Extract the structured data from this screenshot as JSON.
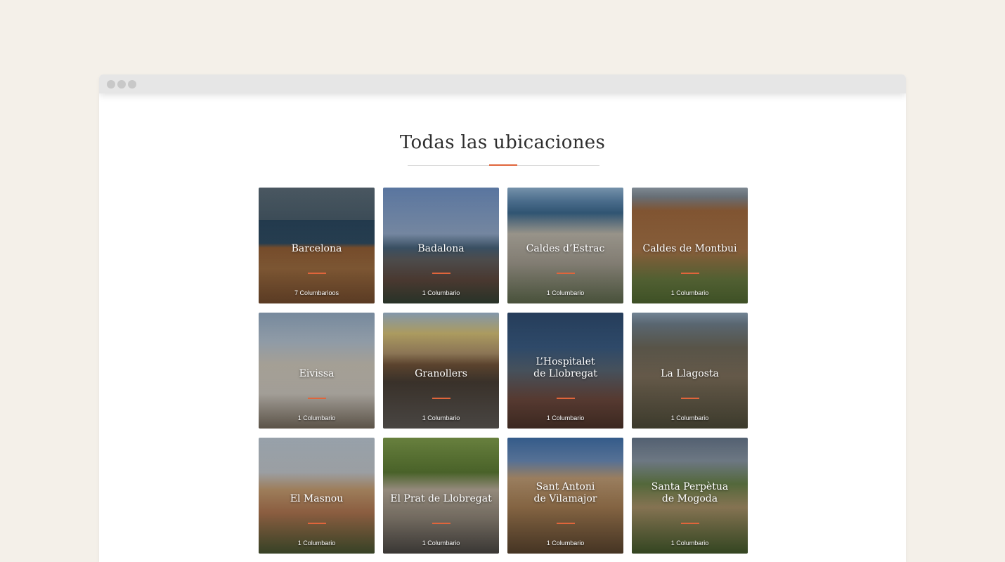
{
  "page": {
    "heading": "Todas las ubicaciones"
  },
  "colors": {
    "background": "#f4f0e9",
    "accent": "#e0653b",
    "chrome": "#e6e6e6"
  },
  "locations": [
    {
      "name": "Barcelona",
      "count": "7 Columbarioos"
    },
    {
      "name": "Badalona",
      "count": "1 Columbario"
    },
    {
      "name": "Caldes d’Estrac",
      "count": "1 Columbario"
    },
    {
      "name": "Caldes de Montbui",
      "count": "1 Columbario"
    },
    {
      "name": "Eivissa",
      "count": "1 Columbario"
    },
    {
      "name": "Granollers",
      "count": "1 Columbario"
    },
    {
      "name": "L’Hospitalet\nde Llobregat",
      "count": "1 Columbario"
    },
    {
      "name": "La Llagosta",
      "count": "1 Columbario"
    },
    {
      "name": "El Masnou",
      "count": "1 Columbario"
    },
    {
      "name": "El Prat de Llobregat",
      "count": "1 Columbario"
    },
    {
      "name": "Sant Antoni\nde Vilamajor",
      "count": "1 Columbario"
    },
    {
      "name": "Santa Perpètua\nde Mogoda",
      "count": "1 Columbario"
    }
  ]
}
